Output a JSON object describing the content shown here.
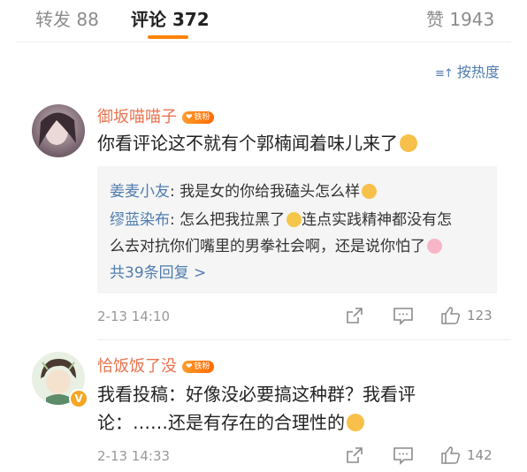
{
  "tabs": {
    "repost": {
      "label": "转发",
      "count": "88"
    },
    "comments": {
      "label": "评论",
      "count": "372"
    },
    "likes": {
      "label": "赞",
      "count": "1943"
    }
  },
  "sort_label": "按热度",
  "comments": [
    {
      "username": "御坂喵喵子",
      "fan_badge": "铁粉",
      "text": "你看评论这不就有个郭楠闻着味儿来了",
      "emoji": "doge-emoji",
      "replies": [
        {
          "name": "姜麦小友",
          "text": "我是女的你给我磕头怎么样"
        },
        {
          "name": "缪蓝染布",
          "text_line1": "怎么把我拉黑了",
          "text_line1b": "连点实践精神都没有怎",
          "text_line2": "么去对抗你们嘴里的男拳社会啊，还是说你怕了"
        }
      ],
      "more_replies": "共39条回复 >",
      "time": "2-13 14:10",
      "like_count": "123"
    },
    {
      "username": "恰饭饭了没",
      "fan_badge": "铁粉",
      "verified": "V",
      "text_line1": "我看投稿：好像没必要搞这种群？我看评",
      "text_line2": "论：……还是有存在的合理性的",
      "time": "2-13 14:33",
      "like_count": "142"
    }
  ],
  "colors": {
    "accent": "#ff8200",
    "username": "#eb7350",
    "link": "#507daf"
  }
}
